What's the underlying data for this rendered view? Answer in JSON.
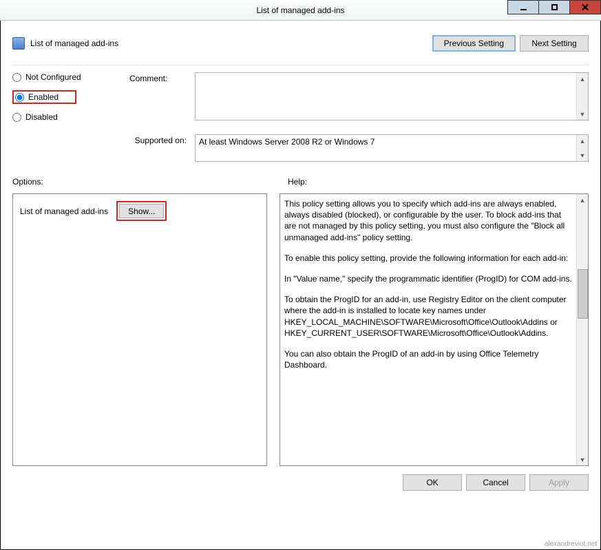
{
  "window": {
    "title": "List of managed add-ins"
  },
  "header": {
    "policy_title": "List of managed add-ins",
    "previous": "Previous Setting",
    "next": "Next Setting"
  },
  "radios": {
    "not_configured": "Not Configured",
    "enabled": "Enabled",
    "disabled": "Disabled",
    "selected": "enabled"
  },
  "labels": {
    "comment": "Comment:",
    "supported_on": "Supported on:",
    "options": "Options:",
    "help": "Help:",
    "options_item": "List of managed add-ins",
    "show": "Show..."
  },
  "supported_text": "At least Windows Server 2008 R2 or Windows 7",
  "help": {
    "p1": "This policy setting allows you to specify which add-ins are always enabled, always disabled (blocked), or configurable by the user. To block add-ins that are not managed by this policy setting, you must also configure the \"Block all unmanaged add-ins\" policy setting.",
    "p2": "To enable this policy setting, provide the following information for each add-in:",
    "p3": "In \"Value name,\" specify the programmatic identifier (ProgID) for COM add-ins.",
    "p4": "To obtain the ProgID for an add-in, use Registry Editor on the client computer where the add-in is installed to locate key names under HKEY_LOCAL_MACHINE\\SOFTWARE\\Microsoft\\Office\\Outlook\\Addins or HKEY_CURRENT_USER\\SOFTWARE\\Microsoft\\Office\\Outlook\\Addins.",
    "p5": "You can also obtain the ProgID of an add-in by using Office Telemetry Dashboard."
  },
  "buttons": {
    "ok": "OK",
    "cancel": "Cancel",
    "apply": "Apply"
  },
  "watermark": "alexandreviot.net"
}
